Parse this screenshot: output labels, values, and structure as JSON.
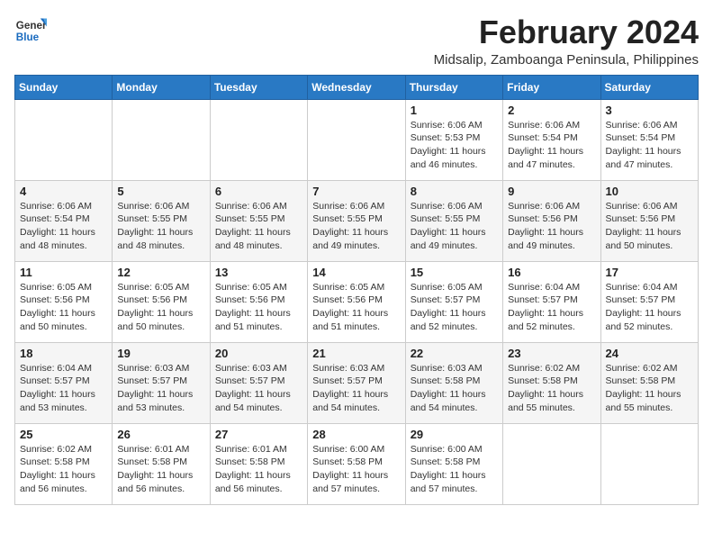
{
  "header": {
    "logo_line1": "General",
    "logo_line2": "Blue",
    "title": "February 2024",
    "subtitle": "Midsalip, Zamboanga Peninsula, Philippines"
  },
  "weekdays": [
    "Sunday",
    "Monday",
    "Tuesday",
    "Wednesday",
    "Thursday",
    "Friday",
    "Saturday"
  ],
  "weeks": [
    [
      {
        "day": "",
        "sunrise": "",
        "sunset": "",
        "daylight": ""
      },
      {
        "day": "",
        "sunrise": "",
        "sunset": "",
        "daylight": ""
      },
      {
        "day": "",
        "sunrise": "",
        "sunset": "",
        "daylight": ""
      },
      {
        "day": "",
        "sunrise": "",
        "sunset": "",
        "daylight": ""
      },
      {
        "day": "1",
        "sunrise": "Sunrise: 6:06 AM",
        "sunset": "Sunset: 5:53 PM",
        "daylight": "Daylight: 11 hours and 46 minutes."
      },
      {
        "day": "2",
        "sunrise": "Sunrise: 6:06 AM",
        "sunset": "Sunset: 5:54 PM",
        "daylight": "Daylight: 11 hours and 47 minutes."
      },
      {
        "day": "3",
        "sunrise": "Sunrise: 6:06 AM",
        "sunset": "Sunset: 5:54 PM",
        "daylight": "Daylight: 11 hours and 47 minutes."
      }
    ],
    [
      {
        "day": "4",
        "sunrise": "Sunrise: 6:06 AM",
        "sunset": "Sunset: 5:54 PM",
        "daylight": "Daylight: 11 hours and 48 minutes."
      },
      {
        "day": "5",
        "sunrise": "Sunrise: 6:06 AM",
        "sunset": "Sunset: 5:55 PM",
        "daylight": "Daylight: 11 hours and 48 minutes."
      },
      {
        "day": "6",
        "sunrise": "Sunrise: 6:06 AM",
        "sunset": "Sunset: 5:55 PM",
        "daylight": "Daylight: 11 hours and 48 minutes."
      },
      {
        "day": "7",
        "sunrise": "Sunrise: 6:06 AM",
        "sunset": "Sunset: 5:55 PM",
        "daylight": "Daylight: 11 hours and 49 minutes."
      },
      {
        "day": "8",
        "sunrise": "Sunrise: 6:06 AM",
        "sunset": "Sunset: 5:55 PM",
        "daylight": "Daylight: 11 hours and 49 minutes."
      },
      {
        "day": "9",
        "sunrise": "Sunrise: 6:06 AM",
        "sunset": "Sunset: 5:56 PM",
        "daylight": "Daylight: 11 hours and 49 minutes."
      },
      {
        "day": "10",
        "sunrise": "Sunrise: 6:06 AM",
        "sunset": "Sunset: 5:56 PM",
        "daylight": "Daylight: 11 hours and 50 minutes."
      }
    ],
    [
      {
        "day": "11",
        "sunrise": "Sunrise: 6:05 AM",
        "sunset": "Sunset: 5:56 PM",
        "daylight": "Daylight: 11 hours and 50 minutes."
      },
      {
        "day": "12",
        "sunrise": "Sunrise: 6:05 AM",
        "sunset": "Sunset: 5:56 PM",
        "daylight": "Daylight: 11 hours and 50 minutes."
      },
      {
        "day": "13",
        "sunrise": "Sunrise: 6:05 AM",
        "sunset": "Sunset: 5:56 PM",
        "daylight": "Daylight: 11 hours and 51 minutes."
      },
      {
        "day": "14",
        "sunrise": "Sunrise: 6:05 AM",
        "sunset": "Sunset: 5:56 PM",
        "daylight": "Daylight: 11 hours and 51 minutes."
      },
      {
        "day": "15",
        "sunrise": "Sunrise: 6:05 AM",
        "sunset": "Sunset: 5:57 PM",
        "daylight": "Daylight: 11 hours and 52 minutes."
      },
      {
        "day": "16",
        "sunrise": "Sunrise: 6:04 AM",
        "sunset": "Sunset: 5:57 PM",
        "daylight": "Daylight: 11 hours and 52 minutes."
      },
      {
        "day": "17",
        "sunrise": "Sunrise: 6:04 AM",
        "sunset": "Sunset: 5:57 PM",
        "daylight": "Daylight: 11 hours and 52 minutes."
      }
    ],
    [
      {
        "day": "18",
        "sunrise": "Sunrise: 6:04 AM",
        "sunset": "Sunset: 5:57 PM",
        "daylight": "Daylight: 11 hours and 53 minutes."
      },
      {
        "day": "19",
        "sunrise": "Sunrise: 6:03 AM",
        "sunset": "Sunset: 5:57 PM",
        "daylight": "Daylight: 11 hours and 53 minutes."
      },
      {
        "day": "20",
        "sunrise": "Sunrise: 6:03 AM",
        "sunset": "Sunset: 5:57 PM",
        "daylight": "Daylight: 11 hours and 54 minutes."
      },
      {
        "day": "21",
        "sunrise": "Sunrise: 6:03 AM",
        "sunset": "Sunset: 5:57 PM",
        "daylight": "Daylight: 11 hours and 54 minutes."
      },
      {
        "day": "22",
        "sunrise": "Sunrise: 6:03 AM",
        "sunset": "Sunset: 5:58 PM",
        "daylight": "Daylight: 11 hours and 54 minutes."
      },
      {
        "day": "23",
        "sunrise": "Sunrise: 6:02 AM",
        "sunset": "Sunset: 5:58 PM",
        "daylight": "Daylight: 11 hours and 55 minutes."
      },
      {
        "day": "24",
        "sunrise": "Sunrise: 6:02 AM",
        "sunset": "Sunset: 5:58 PM",
        "daylight": "Daylight: 11 hours and 55 minutes."
      }
    ],
    [
      {
        "day": "25",
        "sunrise": "Sunrise: 6:02 AM",
        "sunset": "Sunset: 5:58 PM",
        "daylight": "Daylight: 11 hours and 56 minutes."
      },
      {
        "day": "26",
        "sunrise": "Sunrise: 6:01 AM",
        "sunset": "Sunset: 5:58 PM",
        "daylight": "Daylight: 11 hours and 56 minutes."
      },
      {
        "day": "27",
        "sunrise": "Sunrise: 6:01 AM",
        "sunset": "Sunset: 5:58 PM",
        "daylight": "Daylight: 11 hours and 56 minutes."
      },
      {
        "day": "28",
        "sunrise": "Sunrise: 6:00 AM",
        "sunset": "Sunset: 5:58 PM",
        "daylight": "Daylight: 11 hours and 57 minutes."
      },
      {
        "day": "29",
        "sunrise": "Sunrise: 6:00 AM",
        "sunset": "Sunset: 5:58 PM",
        "daylight": "Daylight: 11 hours and 57 minutes."
      },
      {
        "day": "",
        "sunrise": "",
        "sunset": "",
        "daylight": ""
      },
      {
        "day": "",
        "sunrise": "",
        "sunset": "",
        "daylight": ""
      }
    ]
  ]
}
